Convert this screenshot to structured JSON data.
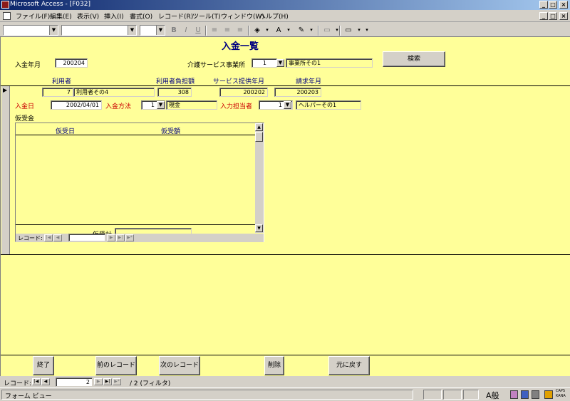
{
  "window": {
    "title": "Microsoft Access - [F032]"
  },
  "menu": [
    "ファイル(F)",
    "編集(E)",
    "表示(V)",
    "挿入(I)",
    "書式(O)",
    "レコード(R)",
    "ツール(T)",
    "ウィンドウ(W)",
    "ヘルプ(H)"
  ],
  "form": {
    "title": "入金一覧",
    "nyukin_nengetsu_label": "入金年月",
    "nyukin_nengetsu_value": "200204",
    "kaigo_jigyosho_label": "介護サービス事業所",
    "kaigo_jigyosho_code": "1",
    "kaigo_jigyosho_name": "事業所その1",
    "search_button": "検索",
    "col_riyosha": "利用者",
    "col_futangaku": "利用者負担額",
    "col_teikyo": "サービス提供年月",
    "col_seikyu": "請求年月",
    "record": {
      "riyosha_id": "7",
      "riyosha_name": "利用者その4",
      "futangaku": "308",
      "teikyo": "200202",
      "seikyu": "200203",
      "nyukinbi_label": "入金日",
      "nyukinbi_value": "2002/04/01",
      "hoho_label": "入金方法",
      "hoho_code": "1",
      "hoho_name": "現金",
      "tanto_label": "入力担当者",
      "tanto_code": "1",
      "tanto_name": "ヘルパーその1",
      "kariuke_label": "仮受金"
    },
    "subform": {
      "col_date": "仮受日",
      "col_amount": "仮受額",
      "total_label": "仮受計",
      "total_value": "",
      "nav_label": "レコード:",
      "nav_value": ""
    },
    "buttons": {
      "end": "終了",
      "prev": "前のレコード",
      "next": "次のレコード",
      "delete": "削除",
      "undo": "元に戻す"
    }
  },
  "navigation": {
    "label": "レコード:",
    "current": "2",
    "total": "/ 2 (フィルタ)"
  },
  "status": {
    "view": "フォーム ビュー",
    "ime": "A般",
    "caps": "CAPS",
    "kana": "KANA"
  }
}
